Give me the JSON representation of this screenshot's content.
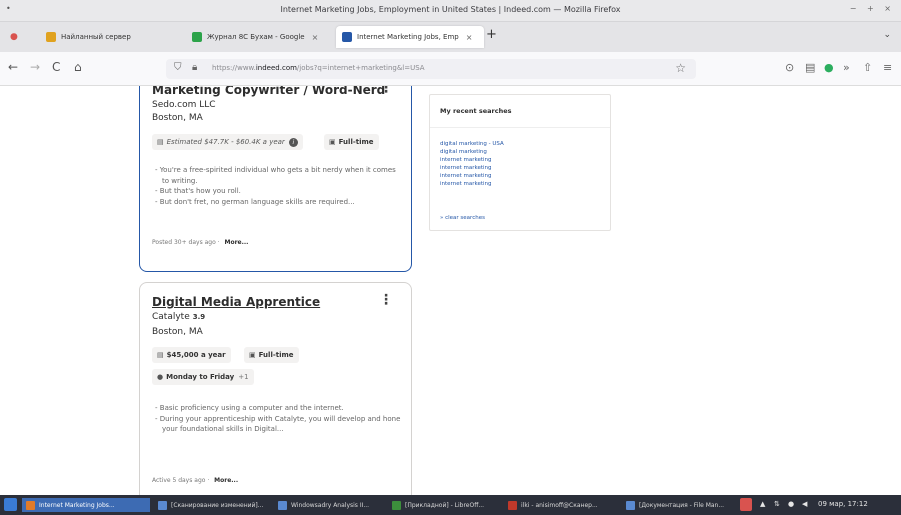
{
  "window": {
    "title": "Internet Marketing Jobs, Employment in United States | Indeed.com — Mozilla Firefox",
    "menu_glyph": "•",
    "controls": "− + ×"
  },
  "tabs": [
    {
      "label": "Найланный сервер",
      "icon": "bookmark-icon",
      "color": "#e0a21f"
    },
    {
      "label": "Журнал 8С Бухам - Google",
      "icon": "sheets-icon",
      "color": "#2ca34a",
      "close": "×"
    },
    {
      "label": "Internet Marketing Jobs, Emp",
      "icon": "indeed-icon",
      "color": "#2557a7",
      "close": "×",
      "active": true
    }
  ],
  "newtab_label": "+",
  "tabmenu_label": "⌄",
  "nav": {
    "back": "←",
    "forward": "→",
    "reload": "C",
    "home": "⌂",
    "url_prefix": "https://www.",
    "url_domain": "indeed.com",
    "url_path": "/jobs?q=internet+marketing&l=USA",
    "star": "☆",
    "right_icons": [
      "⊙",
      "▤",
      "●",
      "»",
      "⇧",
      "≡"
    ]
  },
  "jobs": [
    {
      "title": "Marketing Copywriter / Word-Nerd",
      "company": "Sedo.com LLC",
      "location": "Boston, MA",
      "salary": "Estimated $47.7K - $60.4K a year",
      "salary_estimated": true,
      "job_type": "Full-time",
      "snippet": [
        "You're a free-spirited individual who gets a bit nerdy when it comes to writing.",
        "But that's how you roll.",
        "But don't fret, no german language skills are required..."
      ],
      "posted": "Posted 30+ days ago",
      "more": "More..."
    },
    {
      "title": "Digital Media Apprentice",
      "company": "Catalyte",
      "rating": "3.9",
      "location": "Boston, MA",
      "salary": "$45,000 a year",
      "job_type": "Full-time",
      "schedule": "Monday to Friday",
      "schedule_more": "+1",
      "snippet": [
        "Basic proficiency using a computer and the internet.",
        "During your apprenticeship with Catalyte, you will develop and hone your foundational skills in Digital..."
      ],
      "posted": "Active 5 days ago",
      "more": "More..."
    }
  ],
  "card_menu_glyph": "⋮",
  "recent_searches": {
    "heading": "My recent searches",
    "items": [
      "digital marketing - USA",
      "digital marketing",
      "internet marketing",
      "internet marketing",
      "internet marketing",
      "internet marketing"
    ],
    "clear": "» clear searches"
  },
  "taskbar": {
    "items": [
      {
        "label": "Internet Marketing Jobs...",
        "color": "#e07b2a",
        "active": true
      },
      {
        "label": "[Сканирование изменений]...",
        "color": "#5a8ad1"
      },
      {
        "label": "Windowsadry Analysis II...",
        "color": "#5a8ad1"
      },
      {
        "label": "[Прикладной] - LibreOff...",
        "color": "#3c8f3c"
      },
      {
        "label": "ilki - anisimoff@Сканер...",
        "color": "#c0392b"
      },
      {
        "label": "[Документация - File Man...",
        "color": "#5a8ad1"
      }
    ],
    "clock": "09 мар, 17:12"
  }
}
